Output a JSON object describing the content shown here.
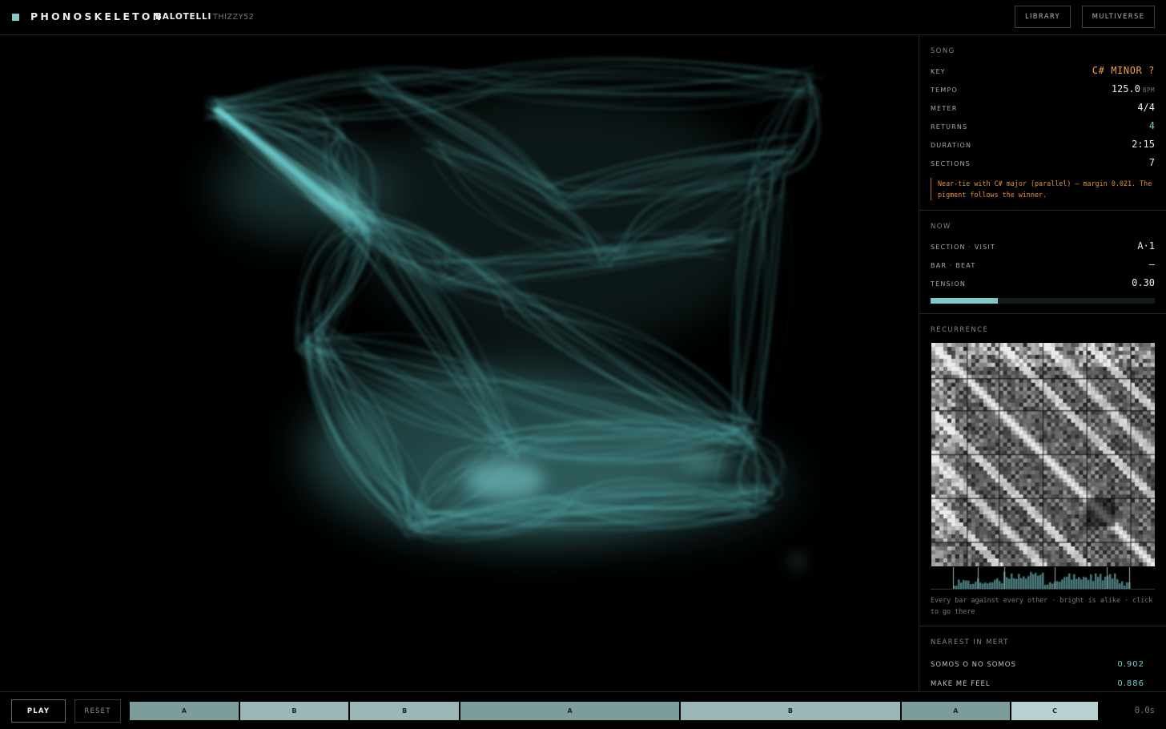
{
  "app": {
    "title": "PHONOSKELETON",
    "song_title": "BALOTELLI",
    "artist": "THIZZY52"
  },
  "nav": {
    "library": "LIBRARY",
    "multiverse": "MULTIVERSE"
  },
  "colors": {
    "accent": "#7fc9c9",
    "key": "#f0a04a",
    "background": "#000000"
  },
  "song": {
    "heading": "SONG",
    "key": {
      "label": "KEY",
      "value": "C# MINOR ?"
    },
    "tempo": {
      "label": "TEMPO",
      "value": "125.0",
      "unit": "BPM"
    },
    "meter": {
      "label": "METER",
      "value": "4/4"
    },
    "returns": {
      "label": "RETURNS",
      "value": "4"
    },
    "duration": {
      "label": "DURATION",
      "value": "2:15"
    },
    "sections": {
      "label": "SECTIONS",
      "value": "7"
    },
    "note": "Near-tie with C# major (parallel) — margin 0.021. The pigment follows the winner."
  },
  "now": {
    "heading": "NOW",
    "section_visit": {
      "label": "SECTION · VISIT",
      "value": "A·1"
    },
    "bar_beat": {
      "label": "BAR · BEAT",
      "value": "—"
    },
    "tension": {
      "label": "TENSION",
      "value": "0.30",
      "level": 0.3
    }
  },
  "recurrence": {
    "heading": "RECURRENCE",
    "caption": "Every bar against every other · bright is alike · click to go there"
  },
  "nearest": {
    "heading": "NEAREST IN MERT",
    "items": [
      {
        "title": "SOMOS O NO SOMOS",
        "score": "0.902"
      },
      {
        "title": "MAKE ME FEEL",
        "score": "0.886"
      }
    ]
  },
  "transport": {
    "play": "PLAY",
    "reset": "RESET",
    "time": "0.0s",
    "sections": [
      {
        "label": "A",
        "duration": 17.3,
        "color": "#7d9d9d"
      },
      {
        "label": "B",
        "duration": 17.3,
        "color": "#9bb7b7"
      },
      {
        "label": "B",
        "duration": 17.3,
        "color": "#9bb7b7"
      },
      {
        "label": "A",
        "duration": 34.6,
        "color": "#7d9d9d"
      },
      {
        "label": "B",
        "duration": 34.6,
        "color": "#9bb7b7"
      },
      {
        "label": "A",
        "duration": 17.3,
        "color": "#7d9d9d"
      },
      {
        "label": "C",
        "duration": 13.8,
        "color": "#b7d0d0"
      }
    ]
  }
}
